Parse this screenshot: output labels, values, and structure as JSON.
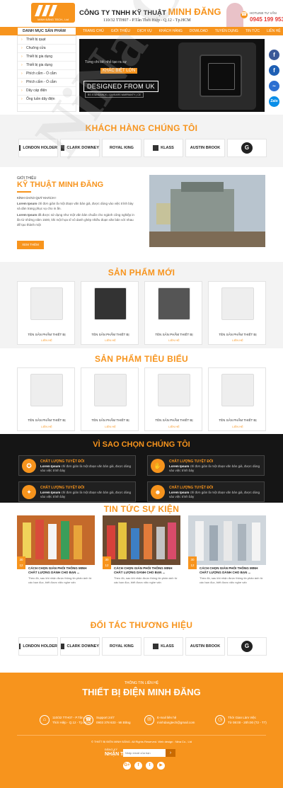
{
  "header": {
    "logo_text": "MINH ĐĂNG TECH., Ltd",
    "company_prefix": "CÔNG TY TNHH KỸ THUẬT ",
    "company_highlight": "MINH ĐĂNG",
    "address": "110/32 TTH07 - P.Tân Thới Hiệp - Q.12 - Tp.HCM",
    "hotline_label": "HOTLINE TƯ VẤN",
    "hotline_number": "0945 199 953"
  },
  "nav": {
    "category_title": "DANH MỤC SẢN PHẨM",
    "menu": [
      "TRANG CHỦ",
      "GIỚI THIỆU",
      "DỊCH VỤ",
      "KHÁCH HÀNG",
      "DOWLOAD",
      "TUYỂN DỤNG",
      "TIN TỨC",
      "LIÊN HỆ"
    ]
  },
  "sidebar": {
    "items": [
      "Thiết bị quạt",
      "Chuông cửa",
      "Thiết bị gia dụng",
      "Thiết bị gia dụng",
      "Phích cắm - Ổ cắm",
      "Phích cắm - Ổ cắm",
      "Dây cáp điện",
      "Ống luồn dây điện"
    ]
  },
  "banner": {
    "line1": "Từng chi tiết nhỏ tạo ra sự",
    "line2": "KHÁC BIỆT LỚN",
    "line3": "DESIGNED FROM UK",
    "line4": "BS STANDARDS | 10 YEARS WARRANTY | CE"
  },
  "social": {
    "zalo": "Zalo"
  },
  "clients": {
    "title": "KHÁCH HÀNG CHÚNG TÔI",
    "logos": [
      "LONDON HOLDER",
      "CLARK DOWNEY",
      "ROYAL KING",
      "KLASS",
      "AUSTIN BROOK",
      "G"
    ]
  },
  "intro": {
    "small": "GIỚI THIỆU",
    "title": "KỸ THUẬT MINH ĐĂNG",
    "greeting": "KÍNH CHÀO QUÝ KHÁCH !",
    "p1_bold": "Lorem Ipsum",
    "p1": " chỉ đơn giản là một đoạn văn bản giả, được dùng vào việc trình bày và dàn trang phục vụ cho in ấn.",
    "p2_bold": "Lorem Ipsum",
    "p2": " đã được sử dụng như một văn bản chuẩn cho ngành công nghiệp in ấn từ những năm 1500, khi một họa sĩ vô danh ghép nhiều đoạn văn bản với nhau để tạo thành một",
    "button": "XEM THÊM"
  },
  "new_products": {
    "title": "SẢN PHẨM MỚI",
    "items": [
      {
        "name": "TÊN SẢN PHẨM THIẾT BỊ",
        "link": "LIÊN HỆ"
      },
      {
        "name": "TÊN SẢN PHẨM THIẾT BỊ",
        "link": "LIÊN HỆ"
      },
      {
        "name": "TÊN SẢN PHẨM THIẾT BỊ",
        "link": "LIÊN HỆ"
      },
      {
        "name": "TÊN SẢN PHẨM THIẾT BỊ",
        "link": "LIÊN HỆ"
      }
    ]
  },
  "featured_products": {
    "title": "SẢN PHẨM TIÊU BIỂU",
    "items": [
      {
        "name": "TÊN SẢN PHẨM THIẾT BỊ",
        "link": "LIÊN HỆ"
      },
      {
        "name": "TÊN SẢN PHẨM THIẾT BỊ",
        "link": "LIÊN HỆ"
      },
      {
        "name": "TÊN SẢN PHẨM THIẾT BỊ",
        "link": "LIÊN HỆ"
      },
      {
        "name": "TÊN SẢN PHẨM THIẾT BỊ",
        "link": "LIÊN HỆ"
      }
    ]
  },
  "why": {
    "title": "VÌ SAO CHỌN CHÚNG TÔI",
    "items": [
      {
        "heading": "CHẤT LƯỢNG TUYỆT ĐỐI",
        "bold": "Lorem Ipsum",
        "text": " chỉ đơn giản là một đoạn văn bản giả, được dùng vào việc trình bày"
      },
      {
        "heading": "CHẤT LƯỢNG TUYỆT ĐỐI",
        "bold": "Lorem Ipsum",
        "text": " chỉ đơn giản là một đoạn văn bản giả, được dùng vào việc trình bày"
      },
      {
        "heading": "CHẤT LƯỢNG TUYỆT ĐỐI",
        "bold": "Lorem Ipsum",
        "text": " chỉ đơn giản là một đoạn văn bản giả, được dùng vào việc trình bày"
      },
      {
        "heading": "CHẤT LƯỢNG TUYỆT ĐỐI",
        "bold": "Lorem Ipsum",
        "text": " chỉ đơn giản là một đoạn văn bản giả, được dùng vào việc trình bày"
      }
    ]
  },
  "news": {
    "title": "TIN TỨC SỰ KIỆN",
    "items": [
      {
        "day": "30",
        "month": "12",
        "title": "CÁCH CHỌN GIẢN PHỐI THÔNG MINH CHẤT LƯỢNG DÀNH CHO BẠN ...",
        "text": "Theo đó, sau khi nhận được thông tin phản ánh từ các bạn đọc, biết được việc nghe vấn"
      },
      {
        "day": "30",
        "month": "12",
        "title": "CÁCH CHỌN GIẢN PHỐI THÔNG MINH CHẤT LƯỢNG DÀNH CHO BẠN ...",
        "text": "Theo đó, sau khi nhận được thông tin phản ánh từ các bạn đọc, biết được việc nghe vấn"
      },
      {
        "day": "30",
        "month": "12",
        "title": "CÁCH CHỌN GIẢN PHỐI THÔNG MINH CHẤT LƯỢNG DÀNH CHO BẠN ...",
        "text": "Theo đó, sau khi nhận được thông tin phản ánh từ các bạn đọc, biết được việc nghe vấn"
      }
    ]
  },
  "partners": {
    "title": "ĐỐI TÁC THƯƠNG HIỆU",
    "logos": [
      "LONDON HOLDER",
      "CLARK DOWNEY",
      "ROYAL KING",
      "KLASS",
      "AUSTIN BROOK",
      "G"
    ]
  },
  "footer": {
    "small": "THÔNG TIN LIÊN HỆ",
    "big": "THIẾT BỊ ĐIỆN MINH ĐĂNG",
    "contacts": [
      {
        "l1": "110/32 TTH07 - P.Tân",
        "l2": "Thới Hiệp - Q.12 - Tp.HCM"
      },
      {
        "l1": "Support 24/7",
        "l2": "0903 378 633 - Mr.Đăng"
      },
      {
        "l1": "E-mail liên hệ",
        "l2": "minhdangtech@gmail.com"
      },
      {
        "l1": "Thời Gian Làm Việc",
        "l2": "Từ 08:00 - 20h:00 (T2 - T7)"
      }
    ],
    "copyright": "© THIẾT BỊ ĐIỆN MINH ĐĂNG. All Rights Reserved. Web design : Nina Co., Ltd",
    "subscribe_small": "ĐĂNG KÝ",
    "subscribe_big": "NHẬN TIN",
    "input_placeholder": "Nhập email của bạn",
    "social": [
      "G+",
      "f",
      "t",
      "▶"
    ]
  },
  "watermark": "NiNa Co.Ltd"
}
